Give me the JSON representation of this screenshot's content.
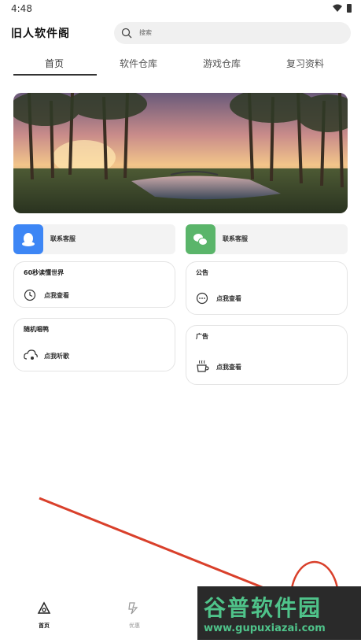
{
  "status_bar": {
    "time": "4:48"
  },
  "header": {
    "app_title": "旧人软件阁",
    "search_placeholder": "搜索"
  },
  "tabs": [
    "首页",
    "软件仓库",
    "游戏仓库",
    "复习资料"
  ],
  "services": [
    {
      "label": "联系客服",
      "icon": "qq-icon",
      "color": "#3d86f5"
    },
    {
      "label": "联系客服",
      "icon": "wechat-icon",
      "color": "#5ab56a"
    }
  ],
  "cards": {
    "news60": {
      "title": "60秒读懂世界",
      "action": "点我查看",
      "icon": "clock-icon"
    },
    "music": {
      "title": "随机唱鸭",
      "action": "点我听歌",
      "icon": "music-cloud-icon"
    },
    "notice": {
      "title": "公告",
      "action": "点我查看",
      "icon": "chat-bubble-icon"
    },
    "ad": {
      "title": "广告",
      "action": "点我查看",
      "icon": "coffee-cup-icon"
    }
  },
  "bottom_nav": [
    {
      "label": "首页",
      "icon": "home-triangle-icon",
      "active": true
    },
    {
      "label": "优惠",
      "icon": "lightning-icon",
      "active": false
    }
  ],
  "watermark": {
    "brand": "谷普软件园",
    "url": "www.gupuxiazai.com"
  },
  "colors": {
    "accent": "#333333",
    "annotation": "#d9402b",
    "watermark_green": "#4fc38a"
  }
}
